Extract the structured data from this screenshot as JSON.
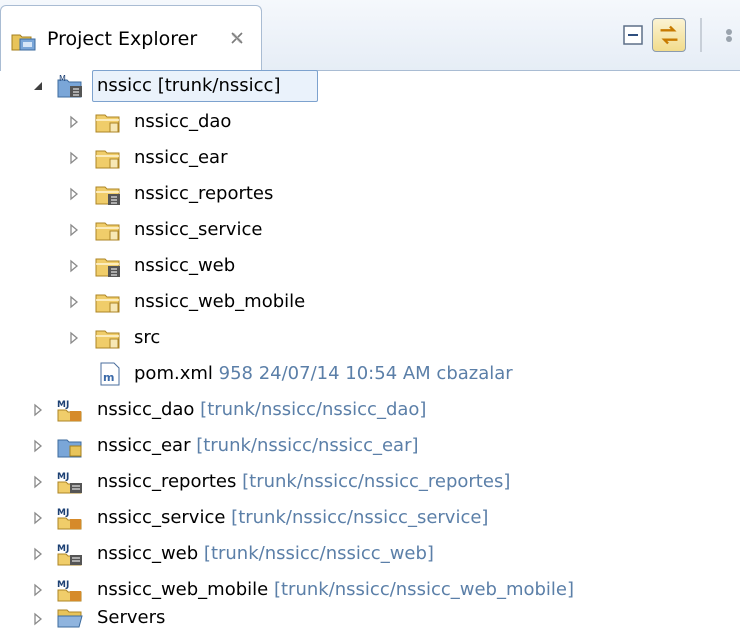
{
  "panel": {
    "title": "Project Explorer",
    "close_glyph": "✕"
  },
  "toolbar": {
    "collapse_all": "collapse-all-icon",
    "link_with_editor": "link-with-editor-icon",
    "view_menu": "view-menu-icon"
  },
  "tree": {
    "root": {
      "name": "nssicc",
      "path": "[trunk/nssicc]",
      "expanded": true
    },
    "children": [
      {
        "name": "nssicc_dao",
        "icon": "folder-icon"
      },
      {
        "name": "nssicc_ear",
        "icon": "folder-icon"
      },
      {
        "name": "nssicc_reportes",
        "icon": "folder-project-icon"
      },
      {
        "name": "nssicc_service",
        "icon": "folder-icon"
      },
      {
        "name": "nssicc_web",
        "icon": "folder-project-icon"
      },
      {
        "name": "nssicc_web_mobile",
        "icon": "folder-icon"
      },
      {
        "name": "src",
        "icon": "folder-icon"
      }
    ],
    "pom": {
      "name": "pom.xml",
      "meta": "958  24/07/14 10:54 AM  cbazalar"
    },
    "projects": [
      {
        "name": "nssicc_dao",
        "path": "[trunk/nssicc/nssicc_dao]",
        "icon": "maven-project-icon"
      },
      {
        "name": "nssicc_ear",
        "path": "[trunk/nssicc/nssicc_ear]",
        "icon": "ear-project-icon"
      },
      {
        "name": "nssicc_reportes",
        "path": "[trunk/nssicc/nssicc_reportes]",
        "icon": "maven-web-project-icon"
      },
      {
        "name": "nssicc_service",
        "path": "[trunk/nssicc/nssicc_service]",
        "icon": "maven-project-icon"
      },
      {
        "name": "nssicc_web",
        "path": "[trunk/nssicc/nssicc_web]",
        "icon": "maven-web-project-icon"
      },
      {
        "name": "nssicc_web_mobile",
        "path": "[trunk/nssicc/nssicc_web_mobile]",
        "icon": "maven-project-icon"
      }
    ],
    "servers": {
      "name": "Servers"
    }
  }
}
